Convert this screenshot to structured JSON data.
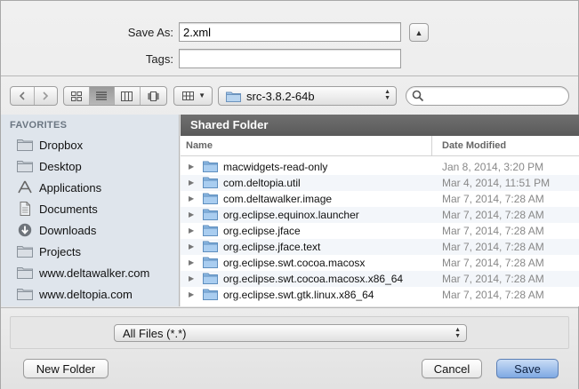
{
  "save_as": {
    "label": "Save As:",
    "value": "2.xml"
  },
  "tags": {
    "label": "Tags:",
    "value": ""
  },
  "toolbar": {
    "location": "src-3.8.2-64b",
    "search_placeholder": ""
  },
  "sidebar": {
    "heading": "FAVORITES",
    "items": [
      {
        "label": "Dropbox",
        "icon": "folder-icon"
      },
      {
        "label": "Desktop",
        "icon": "folder-icon"
      },
      {
        "label": "Applications",
        "icon": "applications-icon"
      },
      {
        "label": "Documents",
        "icon": "documents-icon"
      },
      {
        "label": "Downloads",
        "icon": "downloads-icon"
      },
      {
        "label": "Projects",
        "icon": "folder-icon"
      },
      {
        "label": "www.deltawalker.com",
        "icon": "folder-icon"
      },
      {
        "label": "www.deltopia.com",
        "icon": "folder-icon"
      }
    ]
  },
  "file_list": {
    "title": "Shared Folder",
    "columns": {
      "name": "Name",
      "date": "Date Modified"
    },
    "rows": [
      {
        "name": "macwidgets-read-only",
        "date": "Jan 8, 2014, 3:20 PM"
      },
      {
        "name": "com.deltopia.util",
        "date": "Mar 4, 2014, 11:51 PM"
      },
      {
        "name": "com.deltawalker.image",
        "date": "Mar 7, 2014, 7:28 AM"
      },
      {
        "name": "org.eclipse.equinox.launcher",
        "date": "Mar 7, 2014, 7:28 AM"
      },
      {
        "name": "org.eclipse.jface",
        "date": "Mar 7, 2014, 7:28 AM"
      },
      {
        "name": "org.eclipse.jface.text",
        "date": "Mar 7, 2014, 7:28 AM"
      },
      {
        "name": "org.eclipse.swt.cocoa.macosx",
        "date": "Mar 7, 2014, 7:28 AM"
      },
      {
        "name": "org.eclipse.swt.cocoa.macosx.x86_64",
        "date": "Mar 7, 2014, 7:28 AM"
      },
      {
        "name": "org.eclipse.swt.gtk.linux.x86_64",
        "date": "Mar 7, 2014, 7:28 AM"
      }
    ]
  },
  "filter": {
    "value": "All Files (*.*)"
  },
  "buttons": {
    "new_folder": "New Folder",
    "cancel": "Cancel",
    "save": "Save"
  },
  "colors": {
    "sidebar_bg": "#dfe5ec",
    "header_bar": "#5f5f5f",
    "primary_button": "#7fa9e3"
  }
}
